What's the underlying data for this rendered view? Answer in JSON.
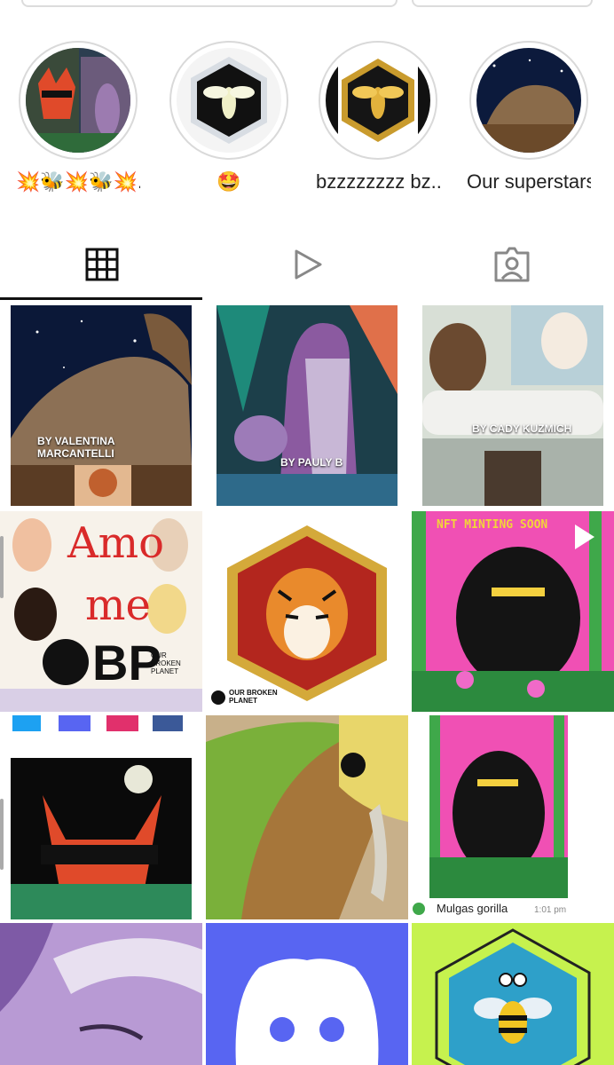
{
  "stories": [
    {
      "label": "💥🐝💥🐝💥...",
      "icon": "fox-collage"
    },
    {
      "label": "🤩",
      "icon": "bee-hexagon-silver"
    },
    {
      "label": "bzzzzzzzz bz...",
      "icon": "bee-hexagon-gold"
    },
    {
      "label": "Our superstars",
      "icon": "bear-landscape"
    }
  ],
  "tabs": [
    {
      "name": "posts",
      "icon": "grid-icon",
      "active": true
    },
    {
      "name": "reels",
      "icon": "play-icon",
      "active": false
    },
    {
      "name": "tagged",
      "icon": "tagged-person-icon",
      "active": false
    }
  ],
  "posts": {
    "p1_caption": "BY VALENTINA MARCANTELLI",
    "p2_caption": "BY PAULY B",
    "p3_caption": "BY CADY KUZMICH",
    "p4_amo": "Amo",
    "p4_me": "me",
    "p4_bp": "BP",
    "p4_sub": "OUR BROKEN PLANET",
    "p5_brand": "OUR BROKEN PLANET",
    "p6_title": "NFT MINTING SOON",
    "p9_caption": "Mulgas gorilla",
    "p9_time": "1:01 pm"
  },
  "colors": {
    "accent": "#111111",
    "ring": "#d9d9d9",
    "discord": "#5865f2",
    "lime": "#c6f24e"
  }
}
